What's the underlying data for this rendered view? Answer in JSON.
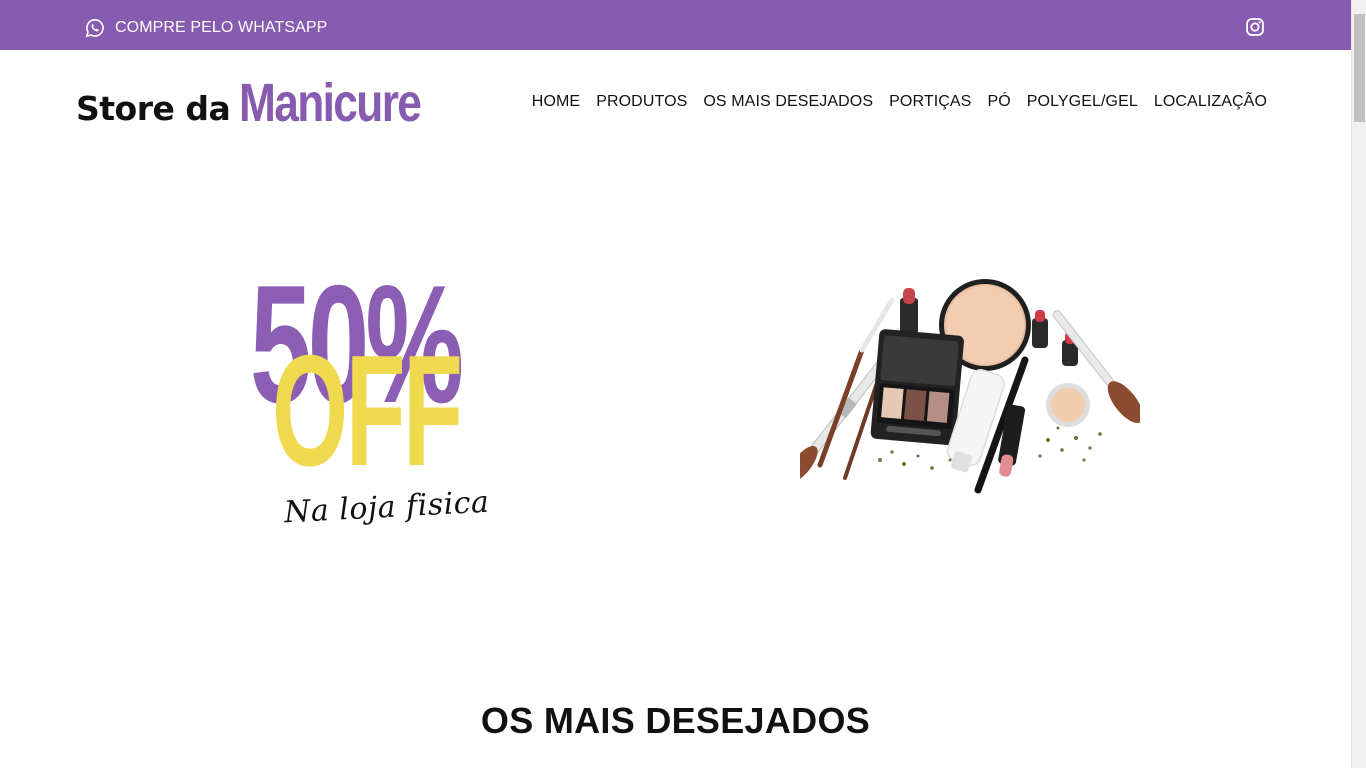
{
  "topbar": {
    "whatsapp_label": "COMPRE PELO WHATSAPP",
    "whatsapp_icon": "whatsapp-icon",
    "instagram_icon": "instagram-icon",
    "background": "#875bb0"
  },
  "logo": {
    "prefix": "Store da",
    "main": "Manicure",
    "accent": "#875bb0"
  },
  "nav": {
    "items": [
      {
        "label": "HOME"
      },
      {
        "label": "PRODUTOS"
      },
      {
        "label": "OS MAIS DESEJADOS"
      },
      {
        "label": "PORTIÇAS"
      },
      {
        "label": "PÓ"
      },
      {
        "label": "POLYGEL/GEL"
      },
      {
        "label": "LOCALIZAÇÃO"
      }
    ]
  },
  "promo": {
    "percent": "50%",
    "off": "OFF",
    "subtitle": "Na loja fisica",
    "percent_color": "#8b5eb4",
    "off_color": "#efd94f"
  },
  "hero_image": {
    "icon": "makeup-products-image"
  },
  "sections": {
    "featured_title": "OS MAIS DESEJADOS"
  }
}
